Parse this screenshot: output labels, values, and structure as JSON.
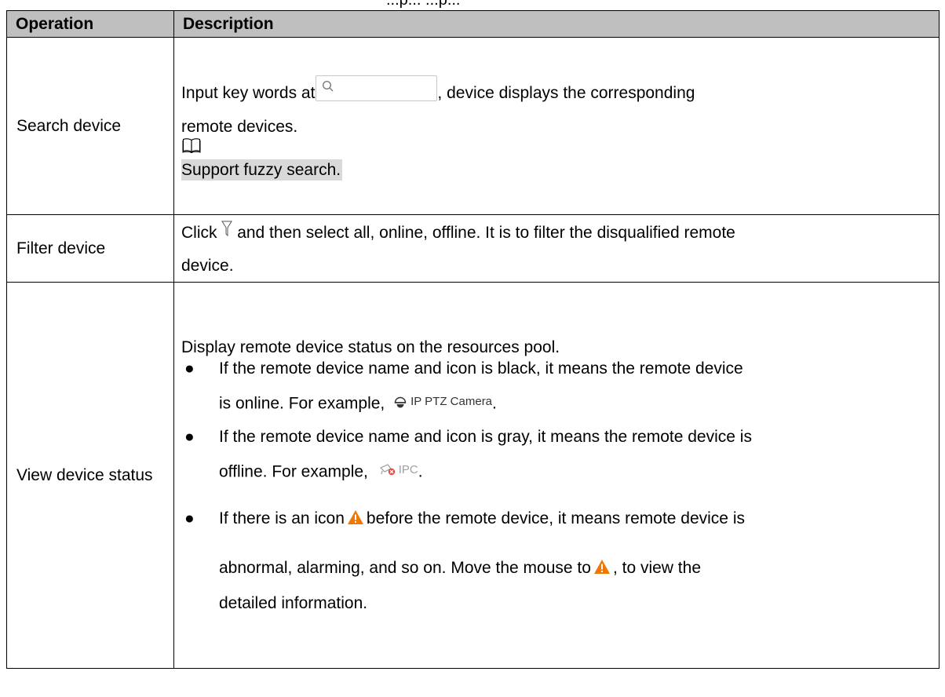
{
  "caption": "...p... ...p...",
  "table": {
    "headers": [
      "Operation",
      "Description"
    ],
    "rows": [
      {
        "operation": "Search device",
        "desc_before_box": "Input key words at",
        "desc_after_box": ", device displays the corresponding",
        "desc_line2": "remote devices.",
        "note": "Support fuzzy search."
      },
      {
        "operation": "Filter device",
        "desc_before_icon": "Click",
        "desc_after_icon": "and then select all, online, offline. It is to filter the disqualified remote",
        "desc_line2": "device."
      },
      {
        "operation": "View device status",
        "intro": "Display remote device status on the resources pool.",
        "bullets": [
          {
            "line1": "If the remote device name and icon is black, it means the remote device",
            "line2_before": "is online. For example,",
            "example_label": "IP PTZ Camera",
            "line2_after": "."
          },
          {
            "line1": "If the remote device name and icon is gray, it means the remote device is",
            "line2_before": "offline. For example,",
            "example_label": "IPC",
            "line2_after": "."
          },
          {
            "line1_before": "If there is an icon",
            "line1_after": "before the remote device, it means remote device is",
            "line2_before": "abnormal, alarming, and so on. Move the mouse to",
            "line2_after": ", to view the",
            "line3": "detailed information."
          }
        ]
      }
    ]
  },
  "colors": {
    "header_bg": "#bfbfbf",
    "note_bg": "#d9d9d9",
    "warning": "#f07800",
    "offline_badge": "#e8463a"
  },
  "icons": [
    "search-icon",
    "book-icon",
    "filter-icon",
    "camera-icon",
    "offline-ipc-icon",
    "warning-icon"
  ]
}
